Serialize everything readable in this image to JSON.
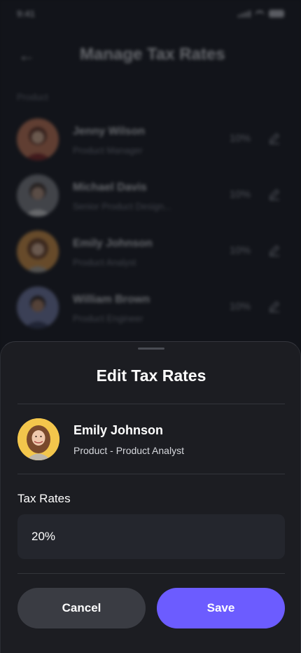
{
  "status_bar": {
    "time": "9:41"
  },
  "background": {
    "header": {
      "title": "Manage Tax Rates",
      "back_icon": "arrow-left-icon"
    },
    "section_label": "Product",
    "employees": [
      {
        "name": "Jenny Wilson",
        "role": "Product Manager",
        "rate": "10%"
      },
      {
        "name": "Michael Davis",
        "role": "Senior Product Design...",
        "rate": "10%"
      },
      {
        "name": "Emily Johnson",
        "role": "Product Analyst",
        "rate": "10%"
      },
      {
        "name": "William Brown",
        "role": "Product Engineer",
        "rate": "10%"
      }
    ],
    "edit_icon": "edit-pencil-icon"
  },
  "sheet": {
    "title": "Edit Tax Rates",
    "employee": {
      "name": "Emily Johnson",
      "role": "Product - Product Analyst"
    },
    "field": {
      "label": "Tax Rates",
      "value": "20%"
    },
    "buttons": {
      "cancel": "Cancel",
      "save": "Save"
    }
  },
  "colors": {
    "accent": "#6c5cff",
    "sheet_bg": "#1c1d22",
    "input_bg": "#24262d",
    "cancel_bg": "#3a3c43"
  }
}
